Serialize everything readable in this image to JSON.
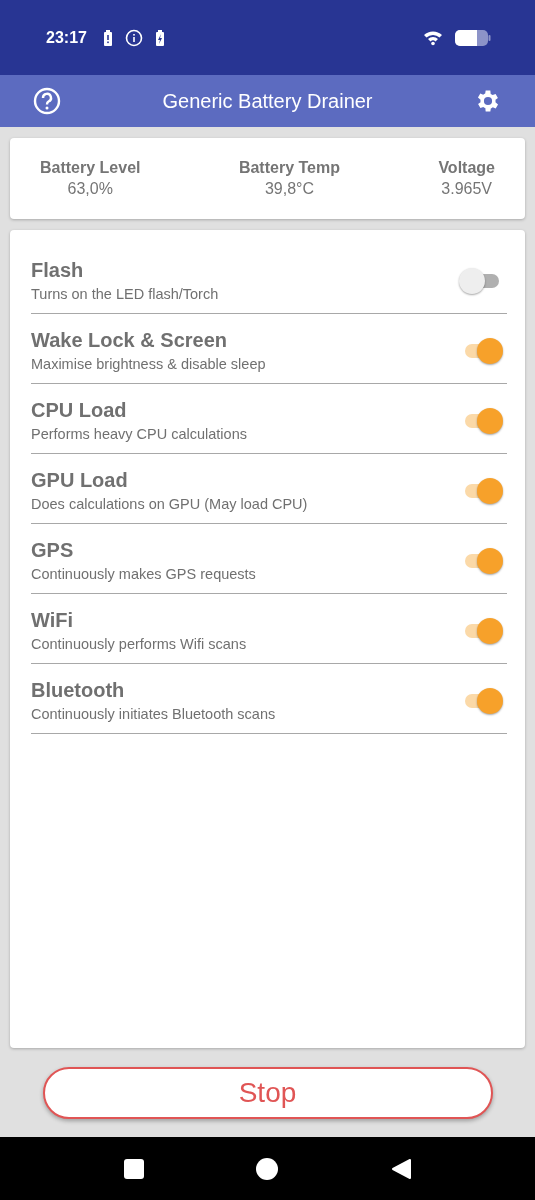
{
  "status_bar": {
    "time": "23:17"
  },
  "app_bar": {
    "title": "Generic Battery Drainer"
  },
  "stats": [
    {
      "label": "Battery Level",
      "value": "63,0%"
    },
    {
      "label": "Battery Temp",
      "value": "39,8°C"
    },
    {
      "label": "Voltage",
      "value": "3.965V"
    }
  ],
  "drainers": [
    {
      "title": "Flash",
      "description": "Turns on the LED flash/Torch",
      "on": false
    },
    {
      "title": "Wake Lock & Screen",
      "description": "Maximise brightness & disable sleep",
      "on": true
    },
    {
      "title": "CPU Load",
      "description": "Performs heavy CPU calculations",
      "on": true
    },
    {
      "title": "GPU Load",
      "description": "Does calculations on GPU (May load CPU)",
      "on": true
    },
    {
      "title": "GPS",
      "description": "Continuously makes GPS requests",
      "on": true
    },
    {
      "title": "WiFi",
      "description": "Continuously performs Wifi scans",
      "on": true
    },
    {
      "title": "Bluetooth",
      "description": "Continuously initiates Bluetooth scans",
      "on": true
    }
  ],
  "stop_button": {
    "label": "Stop"
  }
}
